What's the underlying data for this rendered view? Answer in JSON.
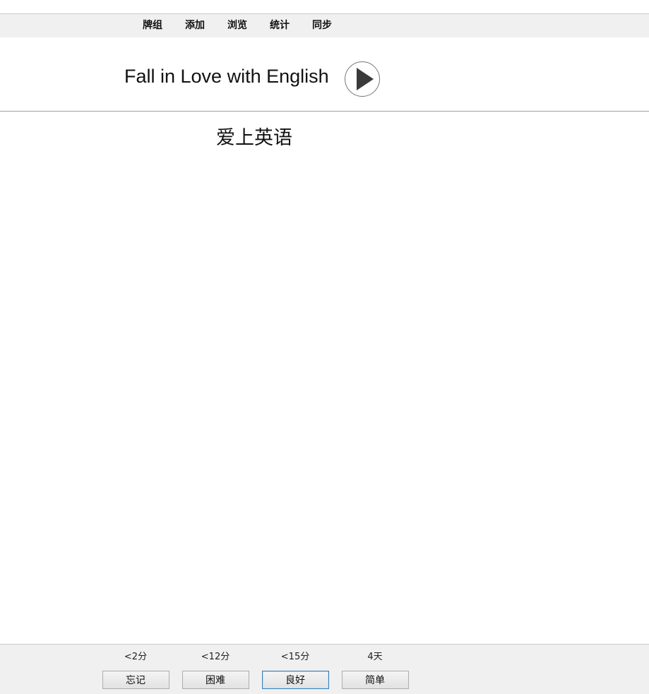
{
  "menu": {
    "items": [
      {
        "label": "牌组"
      },
      {
        "label": "添加"
      },
      {
        "label": "浏览"
      },
      {
        "label": "统计"
      },
      {
        "label": "同步"
      }
    ]
  },
  "card": {
    "front": "Fall in Love with English",
    "back": "爱上英语",
    "audio_icon": "play-icon"
  },
  "answers": [
    {
      "interval": "<2分",
      "label": "忘记"
    },
    {
      "interval": "<12分",
      "label": "困难"
    },
    {
      "interval": "<15分",
      "label": "良好",
      "default": true
    },
    {
      "interval": "4天",
      "label": "简单"
    }
  ],
  "colors": {
    "bar_background": "#f0f0f0",
    "default_button_border": "#3c7fb1",
    "play_icon_fill": "#3a3a3a"
  }
}
